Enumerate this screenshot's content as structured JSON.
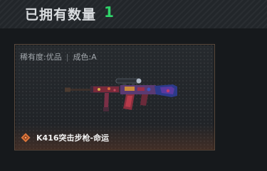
{
  "header": {
    "title": "已拥有数量",
    "count": "1"
  },
  "item": {
    "rarity_label": "稀有度:优品",
    "separator": "|",
    "condition_label": "成色:A",
    "name": "K416突击步枪-命运",
    "rarity_icon": "diamond-rarity-icon",
    "image": "assault-rifle-image"
  },
  "colors": {
    "accent_green": "#2fd46a",
    "card_border": "#5a4a3e",
    "rarity_orange": "#d9743a"
  }
}
